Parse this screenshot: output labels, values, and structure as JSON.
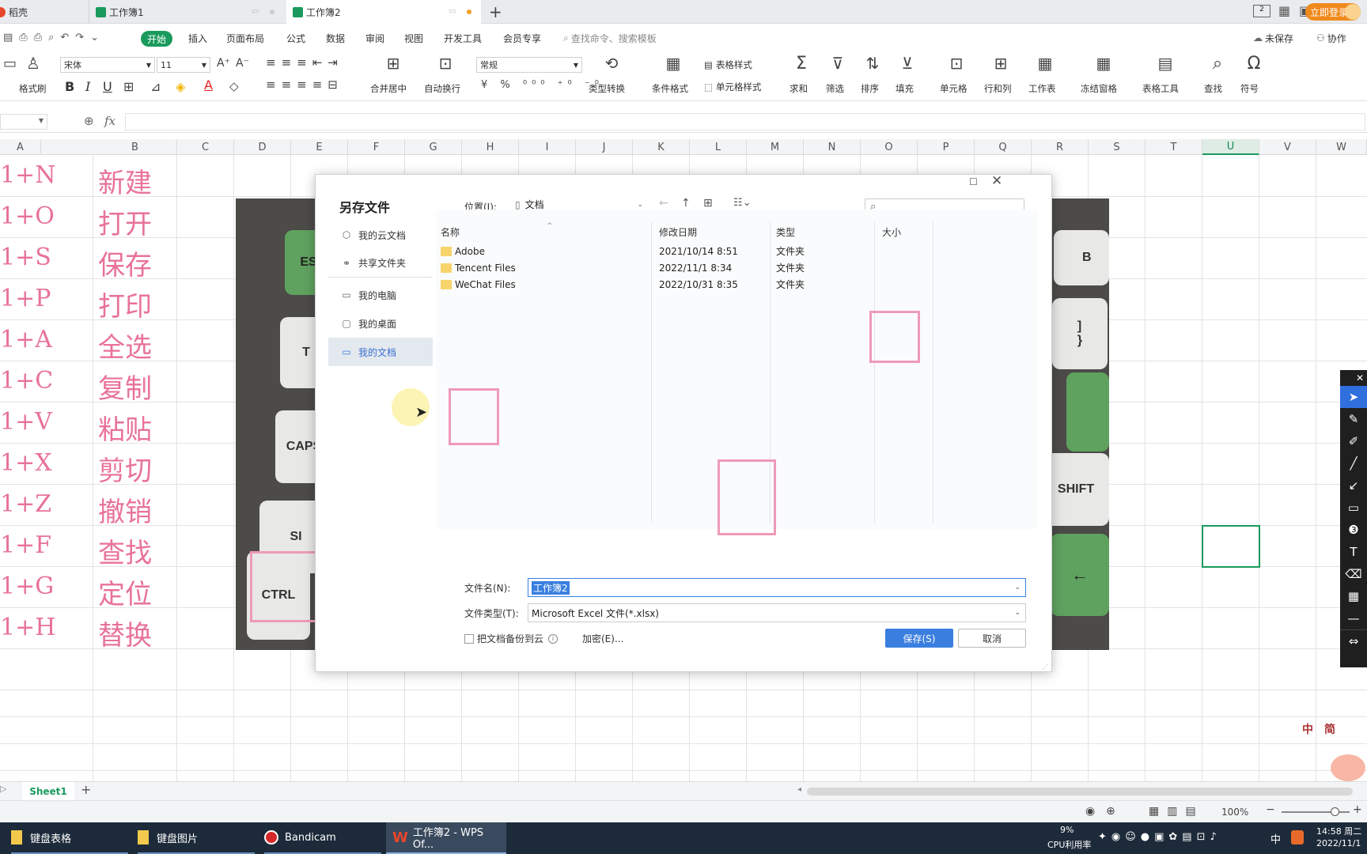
{
  "tabs": [
    {
      "label": "稻壳"
    },
    {
      "label": "工作簿1"
    },
    {
      "label": "工作簿2"
    }
  ],
  "login_label": "立即登录",
  "menu": {
    "items": [
      "开始",
      "插入",
      "页面布局",
      "公式",
      "数据",
      "审阅",
      "视图",
      "开发工具",
      "会员专享"
    ],
    "search_placeholder": "查找命令、搜索模板",
    "unsaved": "未保存",
    "collab": "协作"
  },
  "ribbon": {
    "format_painter": "格式刷",
    "font_name": "宋体",
    "font_size": "11",
    "merge_center": "合并居中",
    "auto_wrap": "自动换行",
    "number_format": "常规",
    "type_convert": "类型转换",
    "cond_format": "条件格式",
    "table_style": "表格样式",
    "cell_style": "单元格样式",
    "sum": "求和",
    "filter": "筛选",
    "sort": "排序",
    "fill": "填充",
    "cell": "单元格",
    "row_col": "行和列",
    "worksheet": "工作表",
    "freeze": "冻结窗格",
    "table_tools": "表格工具",
    "find": "查找",
    "symbol": "符号"
  },
  "formula": {
    "fx": "fx"
  },
  "columns": [
    "A",
    "B",
    "C",
    "D",
    "E",
    "F",
    "G",
    "H",
    "I",
    "J",
    "K",
    "L",
    "M",
    "N",
    "O",
    "P",
    "Q",
    "R",
    "S",
    "T",
    "U",
    "V",
    "W"
  ],
  "rows": [
    {
      "a": "1+N",
      "b": "新建"
    },
    {
      "a": "1+O",
      "b": "打开"
    },
    {
      "a": "1+S",
      "b": "保存"
    },
    {
      "a": "1+P",
      "b": "打印"
    },
    {
      "a": "1+A",
      "b": "全选"
    },
    {
      "a": "1+C",
      "b": "复制"
    },
    {
      "a": "1+V",
      "b": "粘贴"
    },
    {
      "a": "1+X",
      "b": "剪切"
    },
    {
      "a": "1+Z",
      "b": "撤销"
    },
    {
      "a": "1+F",
      "b": "查找"
    },
    {
      "a": "1+G",
      "b": "定位"
    },
    {
      "a": "1+H",
      "b": "替换"
    }
  ],
  "keyboard": {
    "left_keys": [
      "ES",
      "T",
      "CAPS",
      "SI",
      "CTRL"
    ],
    "right_keys": [
      "B",
      "]\n}",
      "SHIFT",
      "←"
    ]
  },
  "dialog": {
    "title": "另存文件",
    "location_label": "位置(I):",
    "location_value": "文档",
    "search_placeholder": "",
    "sidebar": [
      "我的云文档",
      "共享文件夹",
      "我的电脑",
      "我的桌面",
      "我的文档"
    ],
    "headers": {
      "name": "名称",
      "date": "修改日期",
      "type": "类型",
      "size": "大小"
    },
    "files": [
      {
        "name": "Adobe",
        "date": "2021/10/14 8:51",
        "type": "文件夹"
      },
      {
        "name": "Tencent Files",
        "date": "2022/11/1 8:34",
        "type": "文件夹"
      },
      {
        "name": "WeChat Files",
        "date": "2022/10/31 8:35",
        "type": "文件夹"
      }
    ],
    "filename_label": "文件名(N):",
    "filename_value": "工作簿2",
    "filetype_label": "文件类型(T):",
    "filetype_value": "Microsoft Excel 文件(*.xlsx)",
    "backup_label": "把文档备份到云",
    "encrypt_label": "加密(E)...",
    "save_label": "保存(S)",
    "cancel_label": "取消"
  },
  "sheet": {
    "name": "Sheet1"
  },
  "status": {
    "zoom": "100%"
  },
  "taskbar": {
    "items": [
      "键盘表格",
      "键盘图片",
      "Bandicam",
      "工作簿2 - WPS Of..."
    ],
    "cpu_percent": "9%",
    "cpu_label": "CPU利用率",
    "ime": "中",
    "time": "14:58 周二",
    "date": "2022/11/1"
  },
  "sticker": {
    "text1": "中",
    "text2": "简"
  },
  "colors": {
    "accent": "#1a9a5c",
    "pink": "#e8729a",
    "save_blue": "#3a7fe0"
  }
}
